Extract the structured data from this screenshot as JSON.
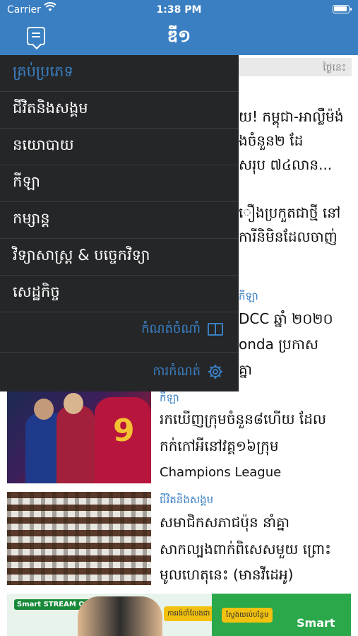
{
  "status_bar": {
    "carrier": "Carrier",
    "time": "1:38 PM"
  },
  "nav": {
    "title": "ឌី១"
  },
  "feed": {
    "date_label": "ថ្ងៃនេះ",
    "items": [
      {
        "lines": [
          "យ! កម្ពុជា-អាល្លឺម៉ង់",
          "ងចំនួន២ ដែ",
          "សរុប ៧៤លាន..."
        ]
      },
      {
        "lines": [
          "ឿងប្រកួតជាថ្មី នៅ",
          "ការីនិមិនដែលចាញ់"
        ]
      },
      {
        "category": "កីឡា",
        "lines": [
          "DCC ឆ្នាំ ២០២០",
          "onda ប្រកាស",
          "គ្នា"
        ]
      },
      {
        "category": "កីឡា",
        "lines": [
          "រកឃើញក្រុមចំនួន៨ហើយ ដែល",
          "កក់កៅអីនៅវគ្គ១៦ក្រុម",
          "Champions League"
        ]
      },
      {
        "category": "ជីវិតនិងសង្គម",
        "lines": [
          "សមាជិកសភាជប៉ុន នាំគ្នា",
          "សាកល្បងពាក់ពិសេសមួយ ព្រោះ",
          "មូលហេតុនេះ (មានវីដេអូ)"
        ]
      }
    ]
  },
  "ad": {
    "stream_label": "Smart STREAM ON",
    "promo_text": "ការរង់ចាំលែងជា បញ្ហាទៀតហើយ!",
    "cta_text": "ស្វែងយល់បន្ថែម",
    "brand": "Smart"
  },
  "drawer": {
    "header": "គ្រប់ប្រភេទ",
    "items": [
      "ជីវិតនិងសង្គម",
      "នយោបាយ",
      "កីឡា",
      "កម្សាន្ត",
      "វិទ្យាសាស្ត្រ & បច្ចេកវិទ្យា",
      "សេដ្ឋកិច្ច"
    ],
    "font_setting": "កំណត់ចំណាំ",
    "settings": "ការកំណត់"
  },
  "colors": {
    "accent": "#3a7fc2",
    "drawer_bg": "#252628"
  }
}
